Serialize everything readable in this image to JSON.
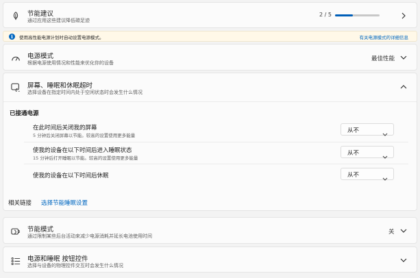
{
  "energy_recommendations": {
    "title": "节能建议",
    "subtitle": "通过应用这些建议降低碳足迹",
    "progress_text": "2 / 5",
    "progress_fraction": 0.4,
    "icon": "leaf-icon"
  },
  "banner": {
    "text": "使用高性能电源计划时自动设置电源模式。",
    "link": "有关电源模式的详细信息",
    "icon": "info-icon"
  },
  "power_mode": {
    "title": "电源模式",
    "subtitle": "根据电源使用情况和性能来优化你的设备",
    "value": "最佳性能",
    "icon": "gauge-icon"
  },
  "screen_sleep": {
    "title": "屏幕、睡眠和休眠超时",
    "subtitle": "选择设备在指定时间内处于空闲状态时会发生什么情况",
    "icon": "screen-sleep-icon",
    "section_label": "已接通电源",
    "rows": [
      {
        "title": "在此时间后关闭我的屏幕",
        "subtitle": "5 分钟后关闭屏幕以节能。较高的设置使用更多能量",
        "value": "从不"
      },
      {
        "title": "使我的设备在以下时间后进入睡眠状态",
        "subtitle": "15 分钟后打开睡眠以节能。较高的设置使用更多能量",
        "value": "从不"
      },
      {
        "title": "使我的设备在以下时间后休眠",
        "subtitle": "",
        "value": "从不"
      }
    ]
  },
  "related": {
    "label": "相关链接",
    "link": "选择节能睡眠设置"
  },
  "energy_saver": {
    "title": "节能模式",
    "subtitle": "通过限制某些后台活动来减少电源消耗并延长电池使用时间",
    "value": "关",
    "icon": "energy-saver-icon"
  },
  "lid_buttons": {
    "title": "电源和睡眠 按钮控件",
    "subtitle": "选择与设备的物理控件交互时会发生什么情况",
    "icon": "buttons-list-icon"
  },
  "colors": {
    "accent": "#005fb8",
    "link": "#0067c0",
    "banner_bg": "#fff8e8"
  }
}
